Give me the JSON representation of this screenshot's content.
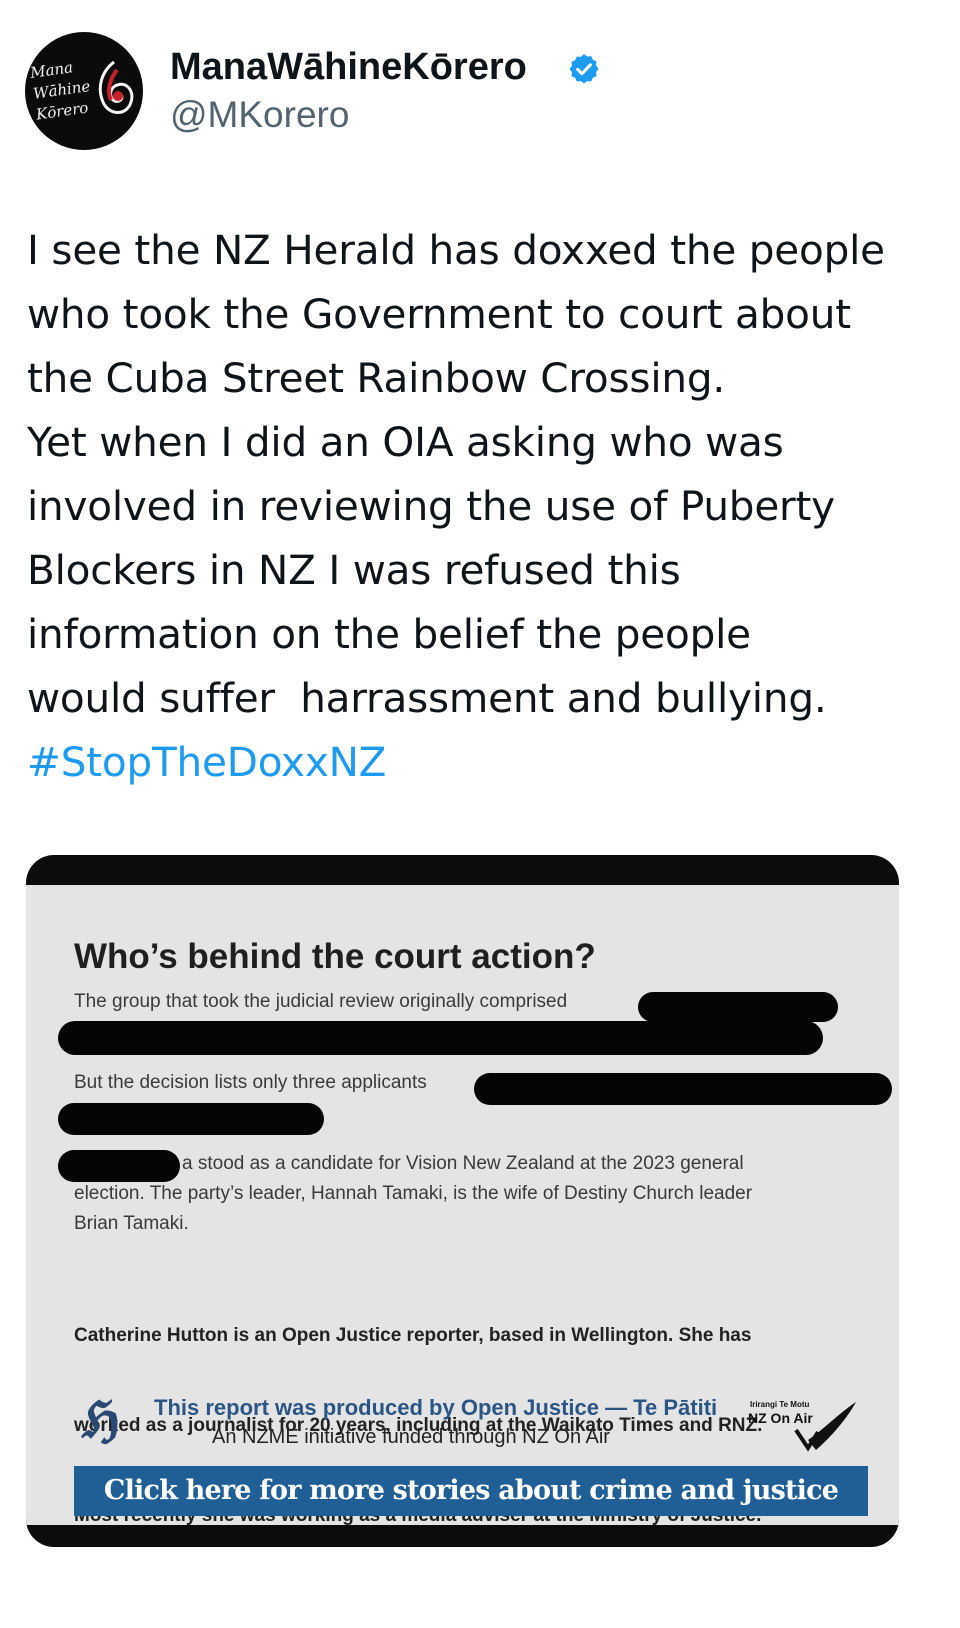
{
  "author": {
    "display_name": "ManaWāhineKōrero",
    "handle": "@MKorero",
    "avatar_lines": [
      "Mana",
      "Wāhine",
      "Kōrero"
    ],
    "verified": true
  },
  "tweet": {
    "lines": [
      "I see the NZ Herald has doxxed the people",
      "who took the Government to court about",
      "the Cuba Street Rainbow Crossing.",
      "Yet when I did an OIA asking who was",
      "involved in reviewing the use of Puberty",
      "Blockers in NZ I was refused this",
      "information on the belief the people",
      "would suffer  harrassment and bullying."
    ],
    "hashtag": "#StopTheDoxxNZ"
  },
  "article": {
    "title": "Who’s behind the court action?",
    "p1": "The group that took the judicial review originally comprised",
    "p2": "But the decision lists only three applicants",
    "p3_lines": [
      "a stood as a candidate for Vision New Zealand at the 2023 general",
      "election. The party’s leader, Hannah Tamaki, is the wife of Destiny Church leader",
      "Brian Tamaki."
    ],
    "bio_lines": [
      "Catherine Hutton is an Open Justice reporter, based in Wellington. She has",
      "worked as a journalist for 20 years, including at the Waikato Times and RNZ.",
      "Most recently she was working as a media adviser at the Ministry of Justice."
    ],
    "credit_line_1": "This report was produced by Open Justice — Te Pātiti",
    "credit_line_2": "An NZME initiative funded through NZ On Air",
    "nzonair_small": "Irirangi Te Motu",
    "nzonair_big": "NZ On Air",
    "cta": "Click here for more stories about crime and justice"
  },
  "colors": {
    "hashtag": "#1d9bf0",
    "verified": "#1d9bf0",
    "cta_bg": "#1f5f95",
    "article_bg": "#e3e4e3"
  }
}
